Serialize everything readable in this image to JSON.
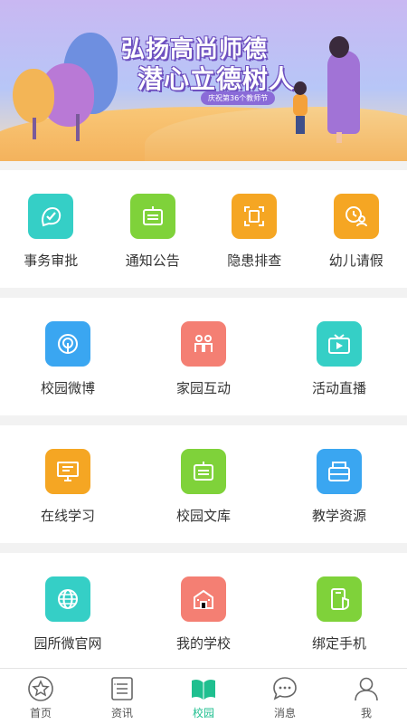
{
  "banner": {
    "headline_line1": "弘扬高尚师德",
    "headline_line2": "潜心立德树人",
    "ribbon": "庆祝第36个教师节"
  },
  "colors": {
    "teal": "#35cfc6",
    "green": "#7fd23a",
    "orange": "#f5a623",
    "blue": "#3aa6f1",
    "salmon": "#f47f73",
    "accent": "#1fbf8f"
  },
  "sections": [
    {
      "items": [
        {
          "label": "事务审批",
          "icon": "approval-icon",
          "color": "#35cfc6"
        },
        {
          "label": "通知公告",
          "icon": "notice-board-icon",
          "color": "#7fd23a"
        },
        {
          "label": "隐患排查",
          "icon": "scan-frame-icon",
          "color": "#f5a623"
        },
        {
          "label": "幼儿请假",
          "icon": "leave-clock-icon",
          "color": "#f5a623"
        }
      ]
    },
    {
      "items": [
        {
          "label": "校园微博",
          "icon": "weibo-broadcast-icon",
          "color": "#3aa6f1"
        },
        {
          "label": "家园互动",
          "icon": "people-interaction-icon",
          "color": "#f47f73"
        },
        {
          "label": "活动直播",
          "icon": "live-tv-icon",
          "color": "#35cfc6"
        }
      ]
    },
    {
      "items": [
        {
          "label": "在线学习",
          "icon": "monitor-icon",
          "color": "#f5a623"
        },
        {
          "label": "校园文库",
          "icon": "library-board-icon",
          "color": "#7fd23a"
        },
        {
          "label": "教学资源",
          "icon": "resource-stack-icon",
          "color": "#3aa6f1"
        }
      ]
    },
    {
      "items": [
        {
          "label": "园所微官网",
          "icon": "globe-icon",
          "color": "#35cfc6"
        },
        {
          "label": "我的学校",
          "icon": "school-building-icon",
          "color": "#f47f73"
        },
        {
          "label": "绑定手机",
          "icon": "phone-shield-icon",
          "color": "#7fd23a"
        }
      ]
    }
  ],
  "tabbar": [
    {
      "label": "首页",
      "icon": "star-icon"
    },
    {
      "label": "资讯",
      "icon": "news-list-icon"
    },
    {
      "label": "校园",
      "icon": "open-book-icon",
      "active": true
    },
    {
      "label": "消息",
      "icon": "chat-bubble-icon"
    },
    {
      "label": "我",
      "icon": "person-icon"
    }
  ]
}
